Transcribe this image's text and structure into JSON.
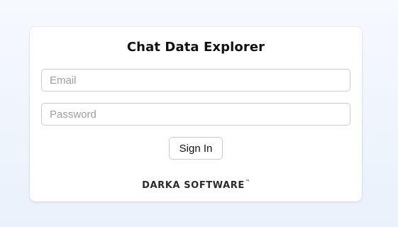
{
  "login_card": {
    "title": "Chat Data Explorer",
    "email_placeholder": "Email",
    "email_value": "",
    "password_placeholder": "Password",
    "password_value": "",
    "signin_label": "Sign In",
    "brand_name": "DARKA SOFTWARE",
    "brand_trademark": "™"
  },
  "colors": {
    "background": "#eef3fb",
    "card": "#ffffff",
    "border": "#c8cbd0",
    "text": "#111111"
  }
}
